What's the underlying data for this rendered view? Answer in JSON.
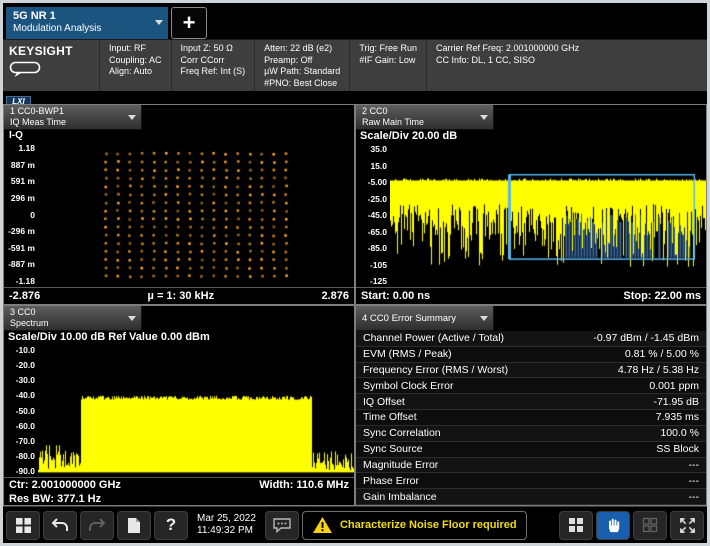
{
  "tabs": {
    "active": {
      "line1": "5G NR 1",
      "line2": "Modulation Analysis"
    },
    "add_label": "+"
  },
  "header": {
    "brand": "KEYSIGHT",
    "lxi": "LXI",
    "columns": [
      [
        "Input: RF",
        "Coupling: AC",
        "Align: Auto"
      ],
      [
        "Input Z: 50 Ω",
        "Corr CCorr",
        "Freq Ref: Int (S)"
      ],
      [
        "Atten: 22 dB (e2)",
        "Preamp: Off",
        "µW Path: Standard",
        "#PNO: Best Close"
      ],
      [
        "Trig: Free Run",
        "#IF Gain: Low"
      ],
      [
        "Carrier Ref Freq: 2.001000000 GHz",
        "CC Info: DL, 1 CC, SISO"
      ]
    ]
  },
  "window1": {
    "title_line1": "1 CC0-BWP1",
    "title_line2": "IQ Meas Time",
    "trace_label": "I-Q",
    "y_labels": [
      "1.18",
      "887 m",
      "591 m",
      "296 m",
      "0",
      "-296 m",
      "-591 m",
      "-887 m",
      "-1.18"
    ],
    "x_left": "-2.876",
    "x_center": "µ = 1: 30 kHz",
    "x_right": "2.876"
  },
  "window2": {
    "title_line1": "2 CC0",
    "title_line2": "Raw Main Time",
    "scale_label": "Scale/Div 20.00 dB",
    "y_labels": [
      "35.0",
      "15.0",
      "-5.00",
      "-25.0",
      "-45.0",
      "-65.0",
      "-85.0",
      "-105",
      "-125"
    ],
    "x_left": "Start: 0.00 ns",
    "x_right": "Stop: 22.00 ms"
  },
  "window3": {
    "title_line1": "3 CC0",
    "title_line2": "Spectrum",
    "scale_label": "Scale/Div 10.00 dB Ref Value 0.00 dBm",
    "y_labels": [
      "-10.0",
      "-20.0",
      "-30.0",
      "-40.0",
      "-50.0",
      "-60.0",
      "-70.0",
      "-80.0",
      "-90.0"
    ],
    "ctr_label": "Ctr: 2.001000000 GHz",
    "width_label": "Width: 110.6 MHz",
    "resbw_label": "Res BW: 377.1 Hz"
  },
  "window4": {
    "title": "4 CC0 Error Summary",
    "rows": [
      {
        "label": "Channel Power (Active / Total)",
        "value": "-0.97 dBm / -1.45 dBm"
      },
      {
        "label": "EVM (RMS / Peak)",
        "value": "0.81 % / 5.00 %"
      },
      {
        "label": "Frequency Error (RMS / Worst)",
        "value": "4.78 Hz / 5.38 Hz"
      },
      {
        "label": "Symbol Clock Error",
        "value": "0.001 ppm"
      },
      {
        "label": "IQ Offset",
        "value": "-71.95 dB"
      },
      {
        "label": "Time Offset",
        "value": "7.935 ms"
      },
      {
        "label": "Sync Correlation",
        "value": "100.0 %"
      },
      {
        "label": "Sync Source",
        "value": "SS Block"
      },
      {
        "label": "Magnitude Error",
        "value": "---"
      },
      {
        "label": "Phase Error",
        "value": "---"
      },
      {
        "label": "Gain Imbalance",
        "value": "---"
      }
    ]
  },
  "toolbar": {
    "date": "Mar 25, 2022",
    "time": "11:49:32 PM",
    "help_label": "?",
    "warning": "Characterize Noise Floor required"
  },
  "colors": {
    "trace": "#ffff00",
    "constellation": "#ffa430",
    "gate": "#5ab4f0",
    "gate_fill": "#39679e",
    "tab_blue": "#1c5480",
    "warning_yellow": "#f2de00"
  }
}
